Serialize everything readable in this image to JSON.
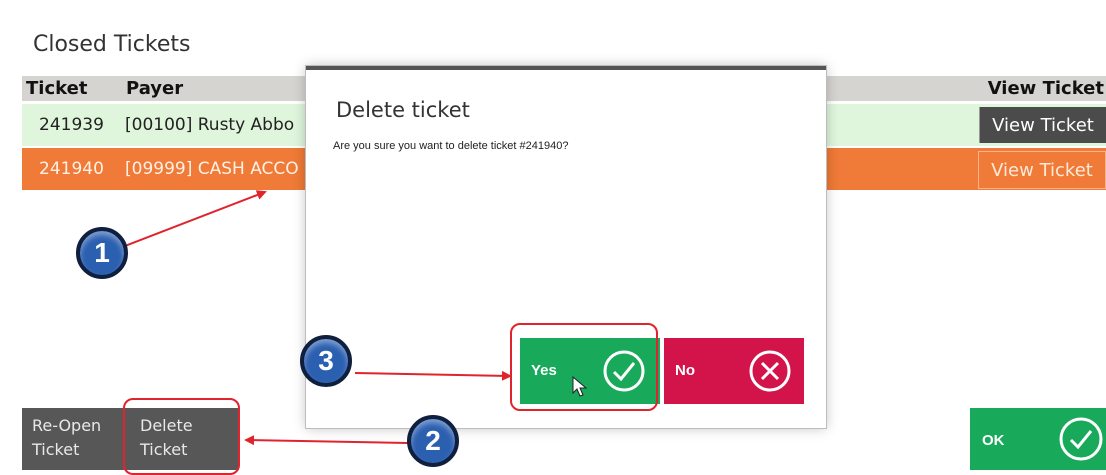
{
  "window": {
    "title": "Closed Tickets"
  },
  "table": {
    "headers": {
      "ticket": "Ticket",
      "payer": "Payer",
      "view": "View Ticket"
    },
    "rows": [
      {
        "ticket": "241939",
        "payer": "[00100] Rusty Abbo",
        "view_label": "View Ticket"
      },
      {
        "ticket": "241940",
        "payer": "[09999] CASH ACCO",
        "view_label": "View Ticket"
      }
    ]
  },
  "buttons": {
    "reopen": {
      "line1": "Re-Open",
      "line2": "Ticket"
    },
    "delete": {
      "line1": "Delete",
      "line2": "Ticket"
    },
    "ok": "OK"
  },
  "dialog": {
    "title": "Delete ticket",
    "message": "Are you sure you want to delete ticket #241940?",
    "yes": "Yes",
    "no": "No"
  },
  "callouts": {
    "one": "1",
    "two": "2",
    "three": "3"
  },
  "colors": {
    "selected_row": "#f07a37",
    "row_highlight": "#dff6dc",
    "confirm_green": "#18a95b",
    "reject_red": "#d2144a",
    "callout_blue": "#2b5fb0",
    "annotation_red": "#e0242d"
  }
}
